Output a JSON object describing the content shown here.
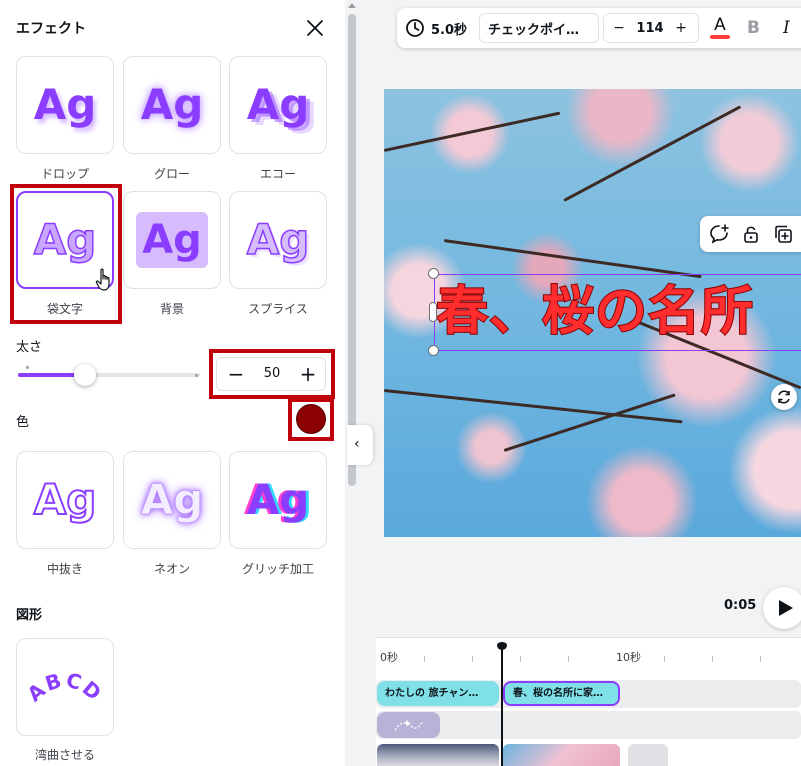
{
  "panel": {
    "title": "エフェクト",
    "tiles_row1": [
      {
        "glyph": "Ag",
        "label": "ドロップ"
      },
      {
        "glyph": "Ag",
        "label": "グロー"
      },
      {
        "glyph": "Ag",
        "label": "エコー"
      }
    ],
    "tiles_row2": [
      {
        "glyph": "Ag",
        "label": "袋文字",
        "selected": true
      },
      {
        "glyph": "Ag",
        "label": "背景"
      },
      {
        "glyph": "Ag",
        "label": "スプライス"
      }
    ],
    "thickness": {
      "label": "太さ",
      "value": "50",
      "slider_fraction": 0.5,
      "minus": "−",
      "plus": "+"
    },
    "color": {
      "label": "色",
      "value": "#8b0000"
    },
    "tiles_row3": [
      {
        "glyph": "Ag",
        "label": "中抜き"
      },
      {
        "glyph": "Ag",
        "label": "ネオン"
      },
      {
        "glyph": "Ag",
        "label": "グリッチ加工"
      }
    ],
    "shapes": {
      "label": "図形",
      "tile_text": "ABCD",
      "tile_label": "湾曲させる"
    },
    "collapse_icon": "‹"
  },
  "toolbar": {
    "duration": "5.0秒",
    "font": "チェックポイ…",
    "font_size": "114",
    "size_minus": "−",
    "size_plus": "+",
    "text_color_letter": "A",
    "text_color": "#ff3b3b",
    "bold": "B",
    "italic": "I"
  },
  "canvas": {
    "headline": "春、桜の名所"
  },
  "playback": {
    "time": "0:05"
  },
  "timeline": {
    "ruler": [
      "0秒",
      "10秒"
    ],
    "clips": [
      "わたしの 旅チャン…",
      "春、桜の名所に家…"
    ]
  },
  "colors": {
    "accent": "#8b3dff",
    "highlight_box": "#c0000a"
  }
}
